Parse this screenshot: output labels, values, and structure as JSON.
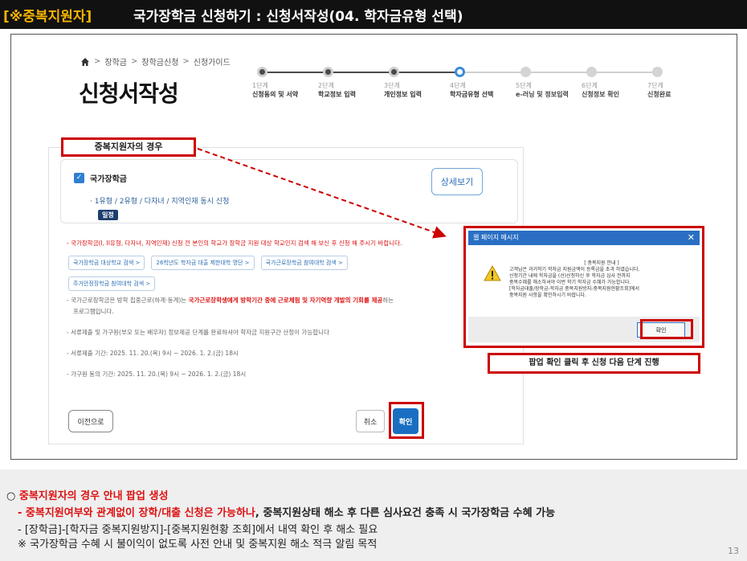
{
  "slide": {
    "title_prefix": "[※중복지원자]",
    "title": "국가장학금 신청하기 : 신청서작성(04. 학자금유형 선택)",
    "page_number": "13"
  },
  "breadcrumb": [
    "장학금",
    "장학금신청",
    "신청가이드"
  ],
  "page_title": "신청서작성",
  "steps": [
    {
      "num": "1단계",
      "label": "신청동의 및 서약"
    },
    {
      "num": "2단계",
      "label": "학교정보 입력"
    },
    {
      "num": "3단계",
      "label": "개인정보 입력"
    },
    {
      "num": "4단계",
      "label": "학자금유형 선택"
    },
    {
      "num": "5단계",
      "label": "e-러닝 및 정보입력"
    },
    {
      "num": "6단계",
      "label": "신청정보 확인"
    },
    {
      "num": "7단계",
      "label": "신청완료"
    }
  ],
  "form": {
    "checkbox_label": "국가장학금",
    "sub_option": "· 1유형 / 2유형 / 다자녀 / 지역인재 동시 신청",
    "badge": "일정",
    "detail_button": "상세보기",
    "notice_red": "- 국가장학금(I, II유형, 다자녀, 지역인재) 신청 전 본인의 학교가 장학금 지원 대상 학교인지 검색 해 보신 후 신청 해 주시기 바랍니다.",
    "links": [
      "국가장학금 대상학교 검색 >",
      "26학년도 학자금 대출 제한대학 명단 >",
      "국가근로장학금 참여대학 검색 >",
      "주거안정장학금 참여대학 검색 >"
    ],
    "note1_pre": "- 국가근로장학금은 방학 집중근로(하계·동계)는 ",
    "note1_red": "국가근로장학생에게 방학기간 중에 근로체험 및 자기역량 개발의 기회를 제공",
    "note1_post": "하는",
    "note1_line2": "프로그램입니다.",
    "note2": "- 서류제출 및 가구원(부모 또는 배우자) 정보제공 단계를 완료하셔야 학자금 지원구간 산정이 가능합니다",
    "note3": "- 서류제출 기간: 2025. 11. 20.(목) 9시 ~ 2026. 1. 2.(금) 18시",
    "note4": "- 가구원 동의 기간: 2025. 11. 20.(목) 9시 ~ 2026. 1. 2.(금) 18시",
    "prev_button": "이전으로",
    "cancel_button": "취소",
    "confirm_button": "확인"
  },
  "callouts": {
    "duplicate_case": "중복지원자의 경우",
    "popup_action": "팝업 확인 클릭 후 신청 다음 단계 진행"
  },
  "popup": {
    "title": "웹 페이지 메시지",
    "close": "✕",
    "heading": "[ 중복지원 안내 ]",
    "lines": [
      "고객님은 과거학기 학자금 지원금액이 등록금을 초과 하였습니다.",
      "신청기간 내에 학자금을 (선)신청하신 후 학자금 심사 전까지",
      "중복수혜를 해소하셔야 이번 학기 학자금 수혜가 가능합니다.",
      "[학자금대출/장학금-학자금 중복지원방지-중복지원현황조회]에서",
      "중복지원 사항을 확인하시기 바랍니다."
    ],
    "ok_button": "확인"
  },
  "notes": {
    "line1": "중복지원자의 경우 안내 팝업 생성",
    "line1_bullet": "○",
    "line2_red": "- 중복지원여부와 관계없이 장학/대출 신청은 가능하나",
    "line2_rest": ", 중복지원상태 해소 후 다른 심사요건 충족 시 국가장학금 수혜 가능",
    "line3": "- [장학금]-[학자금 중복지원방지]-[중복지원현황 조회]에서 내역 확인 후 해소 필요",
    "line4": "※ 국가장학금 수혜 시 불이익이 없도록 사전 안내 및 중복지원 해소 적극 알림 목적"
  },
  "colors": {
    "highlight_red": "#cc0000",
    "primary_blue": "#1a6ec2",
    "title_bar": "#111111",
    "title_accent": "#f5b400"
  },
  "icons": {
    "home": "home-icon",
    "warning": "warning-icon",
    "check": "checkbox-checked-icon"
  }
}
